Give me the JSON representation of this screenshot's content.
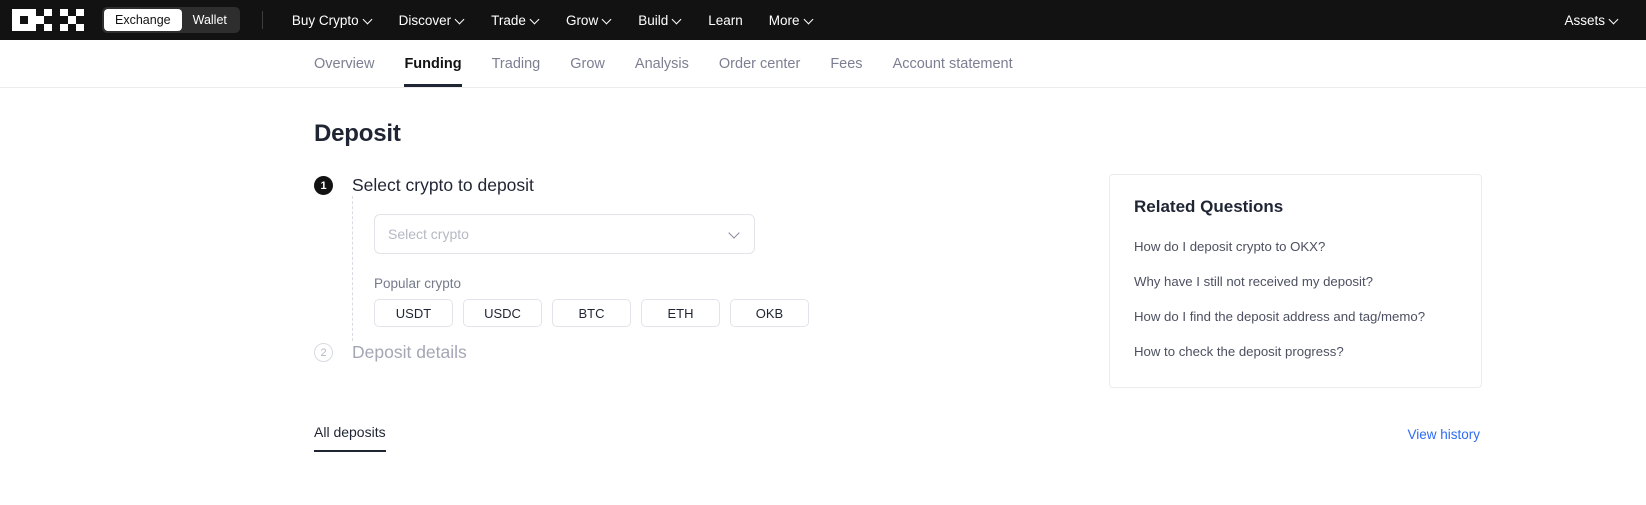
{
  "topnav": {
    "logo_name": "okx-logo",
    "toggle": {
      "exchange": "Exchange",
      "wallet": "Wallet",
      "active": "Exchange"
    },
    "items": [
      {
        "label": "Buy Crypto",
        "caret": true
      },
      {
        "label": "Discover",
        "caret": true
      },
      {
        "label": "Trade",
        "caret": true
      },
      {
        "label": "Grow",
        "caret": true
      },
      {
        "label": "Build",
        "caret": true
      },
      {
        "label": "Learn",
        "caret": false
      },
      {
        "label": "More",
        "caret": true
      }
    ],
    "assets": {
      "label": "Assets",
      "caret": true
    },
    "bg_color": "#121212"
  },
  "subnav": {
    "tabs": [
      {
        "label": "Overview",
        "active": false
      },
      {
        "label": "Funding",
        "active": true
      },
      {
        "label": "Trading",
        "active": false
      },
      {
        "label": "Grow",
        "active": false
      },
      {
        "label": "Analysis",
        "active": false
      },
      {
        "label": "Order center",
        "active": false
      },
      {
        "label": "Fees",
        "active": false
      },
      {
        "label": "Account statement",
        "active": false
      }
    ]
  },
  "page": {
    "title": "Deposit"
  },
  "step1": {
    "number": "1",
    "title": "Select crypto to deposit",
    "select_placeholder": "Select crypto",
    "select_value": "",
    "popular_label": "Popular crypto",
    "chips": [
      "USDT",
      "USDC",
      "BTC",
      "ETH",
      "OKB"
    ]
  },
  "step2": {
    "number": "2",
    "title": "Deposit details"
  },
  "faq": {
    "title": "Related Questions",
    "items": [
      "How do I deposit crypto to OKX?",
      "Why have I still not received my deposit?",
      "How do I find the deposit address and tag/memo?",
      "How to check the deposit progress?"
    ]
  },
  "bottom": {
    "tab_label": "All deposits",
    "view_history": "View history",
    "link_color": "#2e6cf6"
  }
}
